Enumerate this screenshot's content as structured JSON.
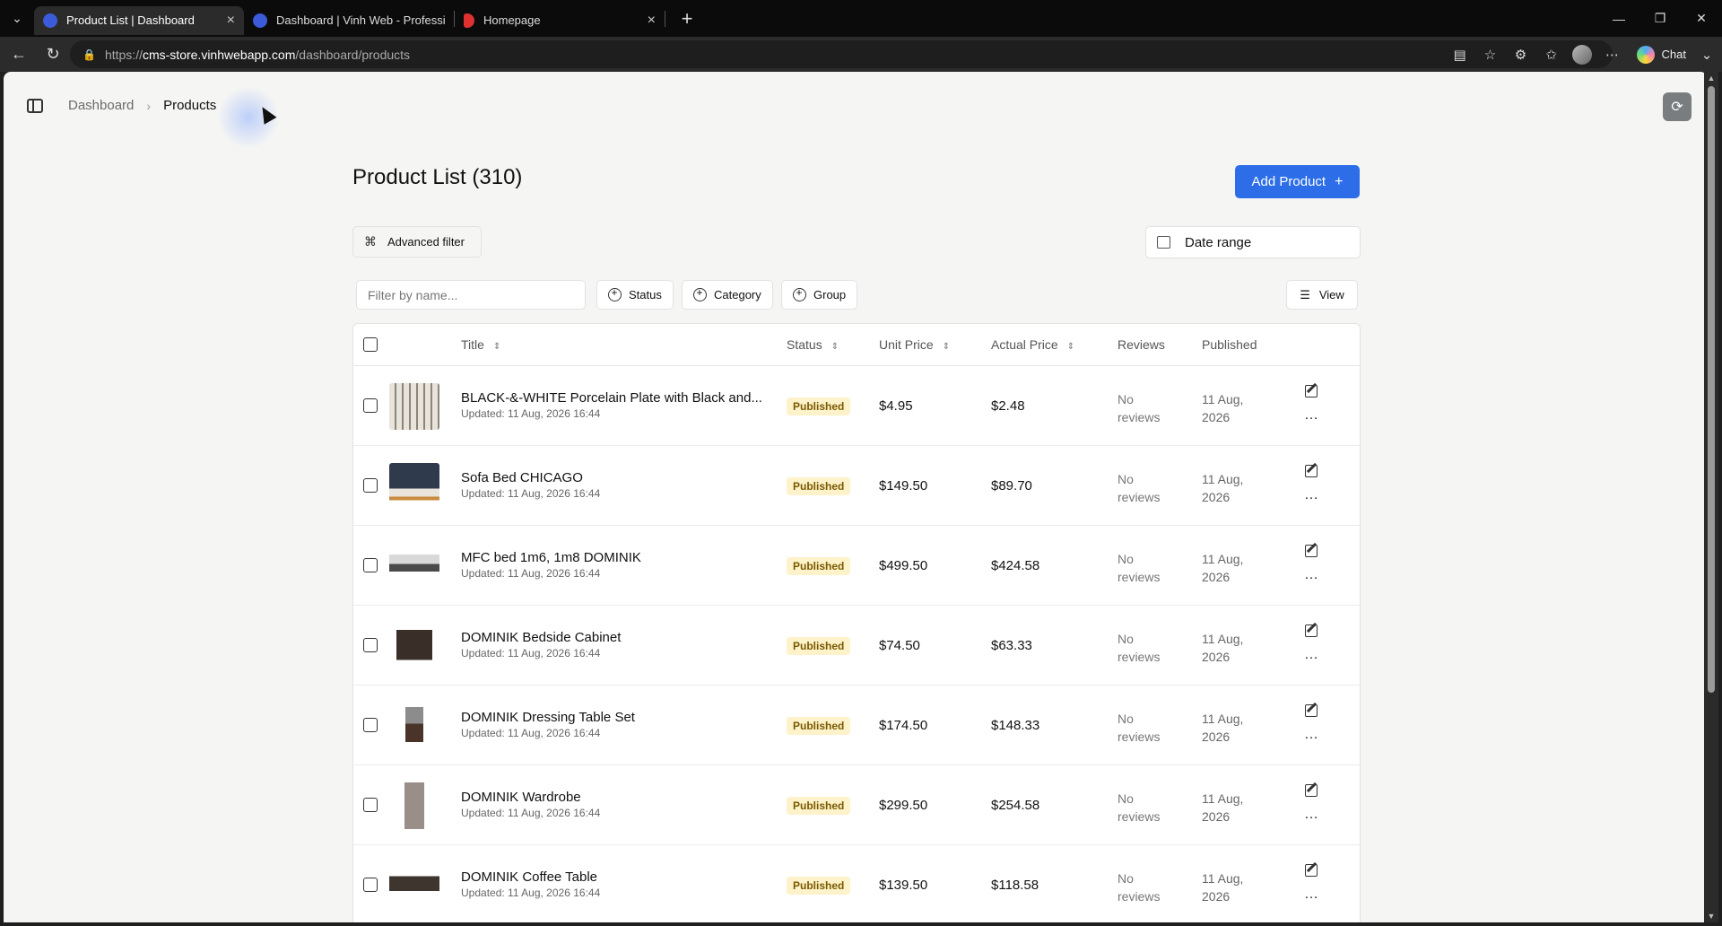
{
  "browser": {
    "tabs": [
      {
        "label": "Product List | Dashboard",
        "active": true,
        "favicon": "v-logo-icon"
      },
      {
        "label": "Dashboard | Vinh Web - Professional",
        "active": false,
        "favicon": "v-logo-icon"
      },
      {
        "label": "Homepage",
        "active": false,
        "favicon": "red-logo-icon"
      }
    ],
    "url_scheme": "https://",
    "url_host": "cms-store.vinhwebapp.com",
    "url_path": "/dashboard/products",
    "chat_label": "Chat"
  },
  "breadcrumb": {
    "home": "Dashboard",
    "separator": "›",
    "current": "Products"
  },
  "page": {
    "title": "Product List (310)",
    "add_button": "Add Product",
    "advanced_filter": "Advanced filter",
    "date_range": "Date range",
    "filter_placeholder": "Filter by name...",
    "chips": {
      "status": "Status",
      "category": "Category",
      "group": "Group"
    },
    "view": "View"
  },
  "table": {
    "columns": {
      "title": "Title",
      "status": "Status",
      "unit_price": "Unit Price",
      "actual_price": "Actual Price",
      "reviews": "Reviews",
      "published": "Published"
    },
    "rows": [
      {
        "title": "BLACK-&-WHITE Porcelain Plate with Black and...",
        "updated": "Updated: 11 Aug, 2026 16:44",
        "status": "Published",
        "unit_price": "$4.95",
        "actual_price": "$2.48",
        "reviews_1": "No",
        "reviews_2": "reviews",
        "published_1": "11 Aug,",
        "published_2": "2026"
      },
      {
        "title": "Sofa Bed CHICAGO",
        "updated": "Updated: 11 Aug, 2026 16:44",
        "status": "Published",
        "unit_price": "$149.50",
        "actual_price": "$89.70",
        "reviews_1": "No",
        "reviews_2": "reviews",
        "published_1": "11 Aug,",
        "published_2": "2026"
      },
      {
        "title": "MFC bed 1m6, 1m8 DOMINIK",
        "updated": "Updated: 11 Aug, 2026 16:44",
        "status": "Published",
        "unit_price": "$499.50",
        "actual_price": "$424.58",
        "reviews_1": "No",
        "reviews_2": "reviews",
        "published_1": "11 Aug,",
        "published_2": "2026"
      },
      {
        "title": "DOMINIK Bedside Cabinet",
        "updated": "Updated: 11 Aug, 2026 16:44",
        "status": "Published",
        "unit_price": "$74.50",
        "actual_price": "$63.33",
        "reviews_1": "No",
        "reviews_2": "reviews",
        "published_1": "11 Aug,",
        "published_2": "2026"
      },
      {
        "title": "DOMINIK Dressing Table Set",
        "updated": "Updated: 11 Aug, 2026 16:44",
        "status": "Published",
        "unit_price": "$174.50",
        "actual_price": "$148.33",
        "reviews_1": "No",
        "reviews_2": "reviews",
        "published_1": "11 Aug,",
        "published_2": "2026"
      },
      {
        "title": "DOMINIK Wardrobe",
        "updated": "Updated: 11 Aug, 2026 16:44",
        "status": "Published",
        "unit_price": "$299.50",
        "actual_price": "$254.58",
        "reviews_1": "No",
        "reviews_2": "reviews",
        "published_1": "11 Aug,",
        "published_2": "2026"
      },
      {
        "title": "DOMINIK Coffee Table",
        "updated": "Updated: 11 Aug, 2026 16:44",
        "status": "Published",
        "unit_price": "$139.50",
        "actual_price": "$118.58",
        "reviews_1": "No",
        "reviews_2": "reviews",
        "published_1": "11 Aug,",
        "published_2": "2026"
      }
    ]
  },
  "colors": {
    "accent": "#2d6ee8",
    "badge_bg": "#fdf2c9",
    "badge_text": "#7a5a00"
  }
}
